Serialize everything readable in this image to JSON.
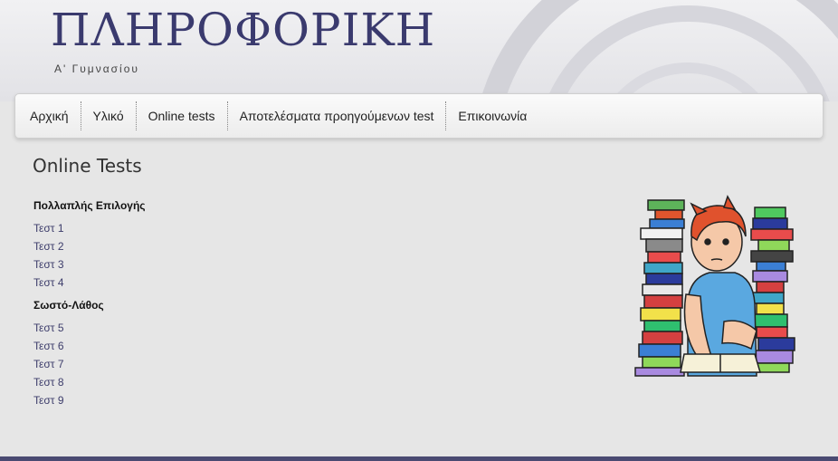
{
  "header": {
    "title": "ΠΛΗΡΟΦΟΡΙΚΗ",
    "subtitle": "Α' Γυμνασίου"
  },
  "nav": {
    "items": [
      "Αρχική",
      "Υλικό",
      "Online tests",
      "Αποτελέσματα προηγούμενων test",
      "Επικοινωνία"
    ]
  },
  "main": {
    "heading": "Online Tests",
    "sections": [
      {
        "title": "Πολλαπλής Επιλογής",
        "links": [
          "Τεστ 1",
          "Τεστ 2",
          "Τεστ 3",
          "Τεστ 4"
        ]
      },
      {
        "title": "Σωστό-Λάθος",
        "links": [
          "Τεστ 5",
          "Τεστ 6",
          "Τεστ 7",
          "Τεστ 8",
          "Τεστ 9"
        ]
      }
    ]
  },
  "colors": {
    "title": "#3a3a6e",
    "link": "#3d3d6b",
    "bottom_bar": "#4a4a72"
  }
}
